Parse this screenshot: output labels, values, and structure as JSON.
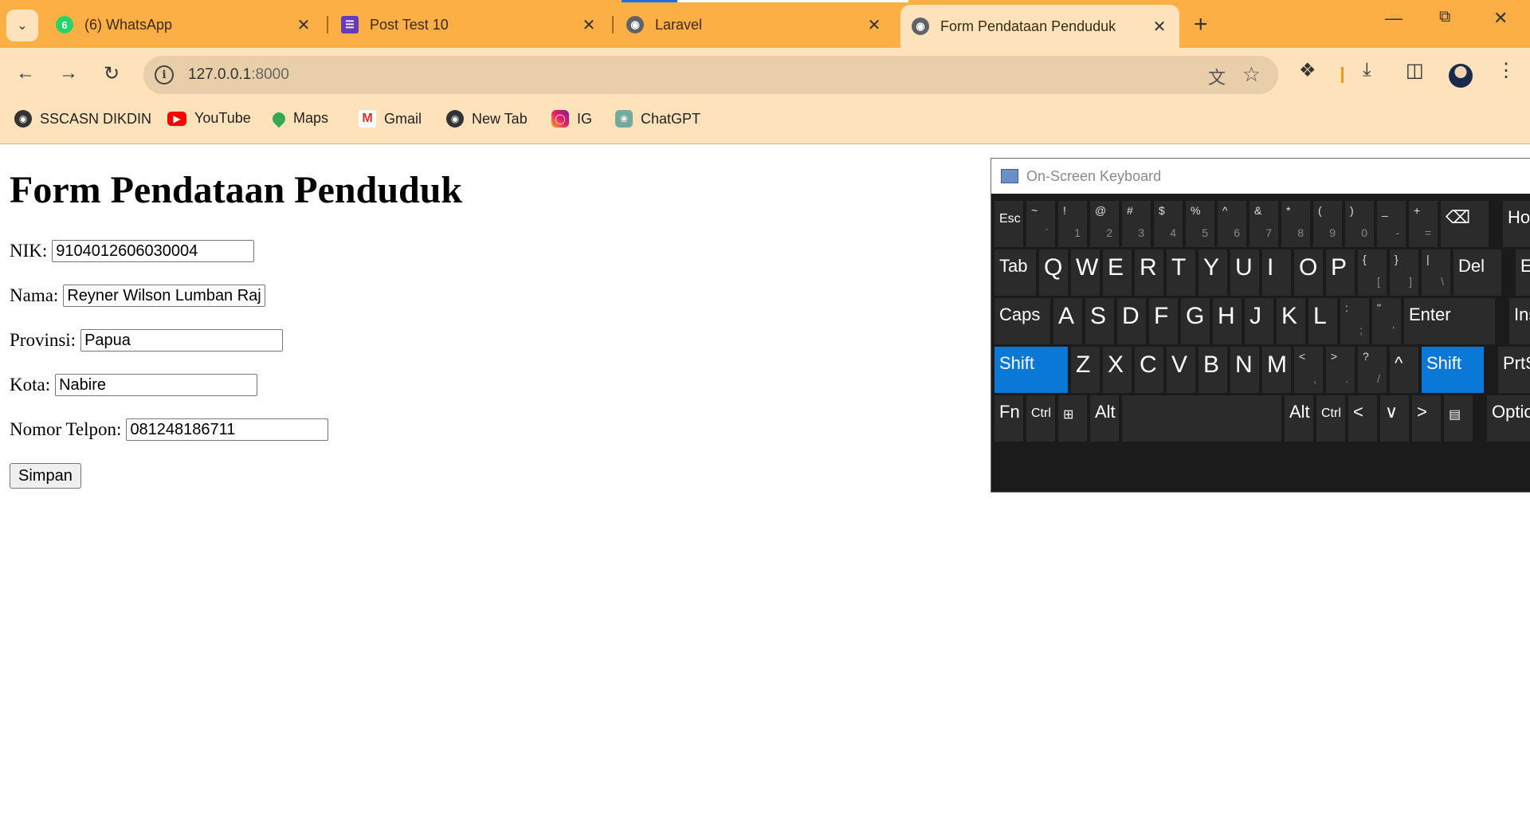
{
  "tabs": [
    {
      "title": "(6) WhatsApp",
      "icon": "whatsapp-icon",
      "badge": "6"
    },
    {
      "title": "Post Test 10",
      "icon": "forms-icon"
    },
    {
      "title": "Laravel",
      "icon": "globe-icon"
    },
    {
      "title": "Form Pendataan Penduduk",
      "icon": "globe-icon",
      "active": true
    }
  ],
  "address_bar": {
    "host": "127.0.0.1",
    "port": ":8000"
  },
  "bookmarks": [
    {
      "label": "SSCASN DIKDIN",
      "icon": "globe-icon"
    },
    {
      "label": "YouTube",
      "icon": "youtube-icon"
    },
    {
      "label": "Maps",
      "icon": "maps-icon"
    },
    {
      "label": "Gmail",
      "icon": "gmail-icon"
    },
    {
      "label": "New Tab",
      "icon": "globe-icon"
    },
    {
      "label": "IG",
      "icon": "instagram-icon"
    },
    {
      "label": "ChatGPT",
      "icon": "chatgpt-icon"
    }
  ],
  "form": {
    "heading": "Form Pendataan Penduduk",
    "fields": {
      "nik": {
        "label": "NIK:",
        "value": "9104012606030004"
      },
      "nama": {
        "label": "Nama:",
        "value": "Reyner Wilson Lumban Raj"
      },
      "provinsi": {
        "label": "Provinsi:",
        "value": "Papua"
      },
      "kota": {
        "label": "Kota:",
        "value": "Nabire"
      },
      "telpon": {
        "label": "Nomor Telpon:",
        "value": "081248186711"
      }
    },
    "submit_label": "Simpan"
  },
  "keyboard": {
    "title": "On-Screen Keyboard",
    "highlight_color": "#0a78d7",
    "rows": {
      "r1": [
        [
          "Esc"
        ],
        [
          "~",
          "`"
        ],
        [
          "!",
          "1"
        ],
        [
          "@",
          "2"
        ],
        [
          "#",
          "3"
        ],
        [
          "$",
          "4"
        ],
        [
          "%",
          "5"
        ],
        [
          "^",
          "6"
        ],
        [
          "&",
          "7"
        ],
        [
          "*",
          "8"
        ],
        [
          "(",
          "9"
        ],
        [
          ")",
          "0"
        ],
        [
          "_",
          "-"
        ],
        [
          "+",
          "="
        ],
        [
          "⌫"
        ],
        [
          "Home"
        ]
      ],
      "r2": [
        [
          "Tab"
        ],
        [
          "Q"
        ],
        [
          "W"
        ],
        [
          "E"
        ],
        [
          "R"
        ],
        [
          "T"
        ],
        [
          "Y"
        ],
        [
          "U"
        ],
        [
          "I"
        ],
        [
          "O"
        ],
        [
          "P"
        ],
        [
          "{",
          "["
        ],
        [
          "}",
          "]"
        ],
        [
          "|",
          "\\"
        ],
        [
          "Del"
        ],
        [
          "End"
        ]
      ],
      "r3": [
        [
          "Caps"
        ],
        [
          "A"
        ],
        [
          "S"
        ],
        [
          "D"
        ],
        [
          "F"
        ],
        [
          "G"
        ],
        [
          "H"
        ],
        [
          "J"
        ],
        [
          "K"
        ],
        [
          "L"
        ],
        [
          ":",
          ";"
        ],
        [
          "\"",
          "'"
        ],
        [
          "Enter"
        ],
        [
          "Insert"
        ]
      ],
      "r4": [
        [
          "Shift"
        ],
        [
          "Z"
        ],
        [
          "X"
        ],
        [
          "C"
        ],
        [
          "V"
        ],
        [
          "B"
        ],
        [
          "N"
        ],
        [
          "M"
        ],
        [
          "<",
          ","
        ],
        [
          ">",
          "."
        ],
        [
          "?",
          "/"
        ],
        [
          "^"
        ],
        [
          "Shift"
        ],
        [
          "PrtScn"
        ]
      ],
      "r5": [
        [
          "Fn"
        ],
        [
          "Ctrl"
        ],
        [
          "⊞"
        ],
        [
          "Alt"
        ],
        [
          ""
        ],
        [
          "Alt"
        ],
        [
          "Ctrl"
        ],
        [
          "<"
        ],
        [
          "∨"
        ],
        [
          ">"
        ],
        [
          "▤"
        ],
        [
          "Options"
        ]
      ]
    }
  }
}
